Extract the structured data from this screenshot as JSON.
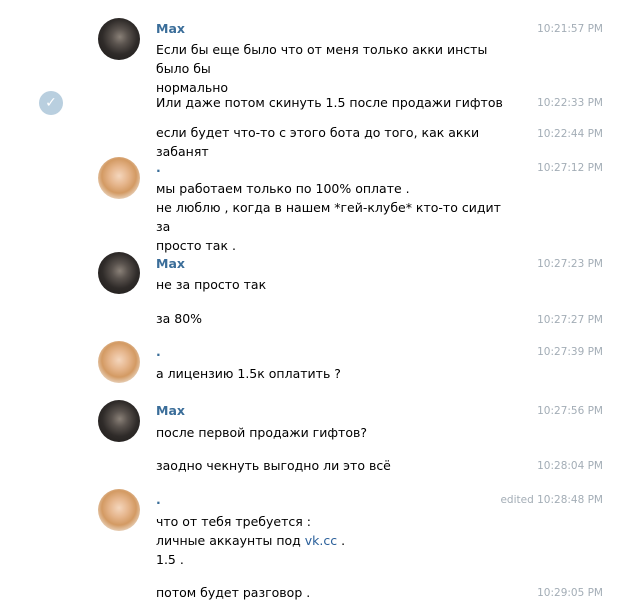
{
  "messages": [
    {
      "type": "first",
      "sender": "Max",
      "avatar": "dark",
      "text": "Если бы еще было что от меня только акки инсты было бы\nнормально",
      "time": "10:21:57 PM"
    },
    {
      "type": "cont",
      "text": "Или даже потом скинуть 1.5 после продажи гифтов",
      "time": "10:22:33 PM",
      "selected": true
    },
    {
      "type": "cont",
      "text": "если будет что-то с этого бота до того, как акки забанят",
      "time": "10:22:44 PM"
    },
    {
      "type": "first",
      "sender": ".",
      "avatar": "light",
      "text": "мы работаем только по 100% оплате .\nне люблю , когда в нашем *гей-клубе* кто-то сидит за\nпросто так .",
      "time": "10:27:12 PM"
    },
    {
      "type": "first",
      "sender": "Max",
      "avatar": "dark",
      "text": "не за просто так",
      "time": "10:27:23 PM"
    },
    {
      "type": "cont",
      "text": "за 80%",
      "time": "10:27:27 PM"
    },
    {
      "type": "first",
      "sender": ".",
      "avatar": "light",
      "text": "а лицензию 1.5к оплатить ?",
      "time": "10:27:39 PM"
    },
    {
      "type": "first",
      "sender": "Max",
      "avatar": "dark",
      "text": "после первой продажи гифтов?",
      "time": "10:27:56 PM"
    },
    {
      "type": "cont",
      "text": "заодно чекнуть выгодно ли это всё",
      "time": "10:28:04 PM"
    },
    {
      "type": "first",
      "sender": ".",
      "avatar": "light",
      "text_line1": "что от тебя требуется :",
      "text_line2_prefix": "личные аккаунты под ",
      "link": "vk.cc",
      "text_line2_suffix": " .",
      "text_line3": "1.5 .",
      "time": "10:28:48 PM",
      "edited": "edited"
    },
    {
      "type": "cont",
      "text": "потом будет разговор .",
      "time": "10:29:05 PM"
    }
  ]
}
